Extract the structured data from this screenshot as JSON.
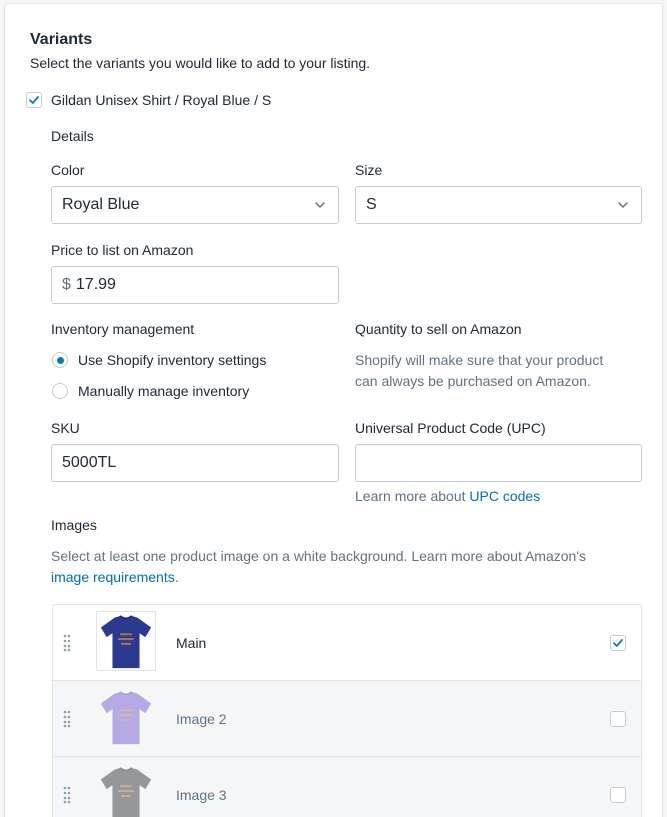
{
  "section": {
    "title": "Variants",
    "subtitle": "Select the variants you would like to add to your listing."
  },
  "variant": {
    "label": "Gildan Unisex Shirt / Royal Blue / S",
    "checked": true
  },
  "details": {
    "heading": "Details",
    "color_label": "Color",
    "color_value": "Royal Blue",
    "size_label": "Size",
    "size_value": "S",
    "price_label": "Price to list on Amazon",
    "price_currency": "$",
    "price_value": "17.99"
  },
  "inventory": {
    "heading": "Inventory management",
    "option_shopify": "Use Shopify inventory settings",
    "option_manual": "Manually manage inventory",
    "selected": "shopify",
    "quantity_heading": "Quantity to sell on Amazon",
    "quantity_help_line1": "Shopify will make sure that your product",
    "quantity_help_line2": "can always be purchased on Amazon."
  },
  "sku": {
    "label": "SKU",
    "value": "5000TL"
  },
  "upc": {
    "label": "Universal Product Code (UPC)",
    "value": "",
    "help_prefix": "Learn more about ",
    "help_link": "UPC codes"
  },
  "images": {
    "heading": "Images",
    "help_line1": "Select at least one product image on a white background. Learn more about Amazon's",
    "help_link": "image requirements",
    "help_suffix": ".",
    "rows": [
      {
        "label": "Main",
        "checked": true,
        "shirt_color": "#2b3a8f"
      },
      {
        "label": "Image 2",
        "checked": false,
        "shirt_color": "#9d8fd1"
      },
      {
        "label": "Image 3",
        "checked": false,
        "shirt_color": "#6b6b6b"
      }
    ]
  },
  "colors": {
    "accent": "#007ace",
    "link": "#006fbb",
    "border": "#c4cdd5"
  }
}
